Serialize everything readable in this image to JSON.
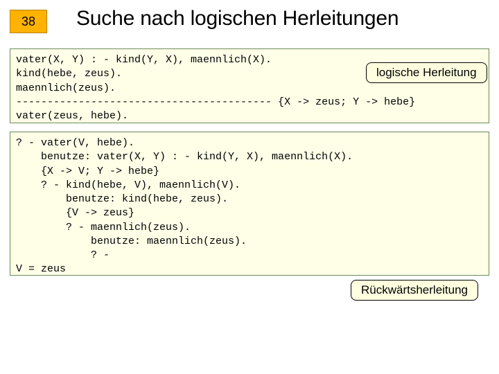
{
  "header": {
    "slide_number": "38",
    "title": "Suche nach logischen Herleitungen"
  },
  "box1": {
    "code": "vater(X, Y) : - kind(Y, X), maennlich(X).\nkind(hebe, zeus).\nmaennlich(zeus).\n----------------------------------------- {X -> zeus; Y -> hebe}\nvater(zeus, hebe).",
    "label": "logische Herleitung"
  },
  "box2": {
    "code": "? - vater(V, hebe).\n    benutze: vater(X, Y) : - kind(Y, X), maennlich(X).\n    {X -> V; Y -> hebe}\n    ? - kind(hebe, V), maennlich(V).\n        benutze: kind(hebe, zeus).\n        {V -> zeus}\n        ? - maennlich(zeus).\n            benutze: maennlich(zeus).\n            ? -\nV = zeus",
    "label": "Rückwärtsherleitung"
  }
}
